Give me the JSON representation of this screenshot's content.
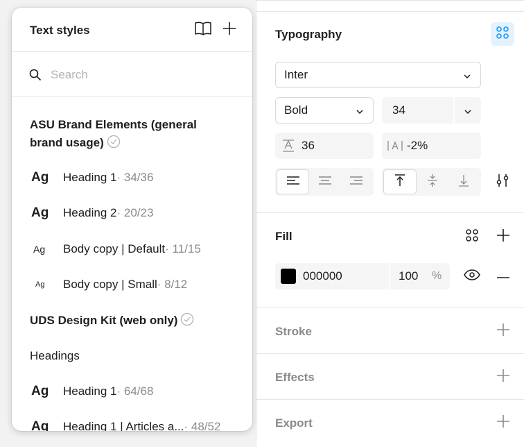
{
  "popover": {
    "title": "Text styles",
    "search_placeholder": "Search",
    "groups": [
      {
        "title": "ASU Brand Elements (general brand usage)",
        "styles": [
          {
            "ag": "Ag",
            "name": "Heading 1",
            "size": " · 34/36"
          },
          {
            "ag": "Ag",
            "name": "Heading 2",
            "size": " · 20/23"
          },
          {
            "ag": "Ag",
            "name": "Body copy | Default",
            "size": " · 11/15"
          },
          {
            "ag": "Ag",
            "name": "Body copy | Small",
            "size": " · 8/12"
          }
        ]
      },
      {
        "title": "UDS Design Kit (web only)",
        "subheading": "Headings",
        "styles": [
          {
            "ag": "Ag",
            "name": "Heading 1",
            "size": " · 64/68"
          },
          {
            "ag": "Ag",
            "name": "Heading 1 | Articles a...",
            "size": " · 48/52"
          }
        ]
      }
    ]
  },
  "typography": {
    "title": "Typography",
    "font_family": "Inter",
    "font_weight": "Bold",
    "font_size": "34",
    "line_height": "36",
    "letter_spacing": "-2%"
  },
  "fill": {
    "title": "Fill",
    "hex": "000000",
    "opacity": "100",
    "opacity_unit": "%",
    "swatch_color": "#000000"
  },
  "stroke": {
    "title": "Stroke"
  },
  "effects": {
    "title": "Effects"
  },
  "export": {
    "title": "Export"
  },
  "colors": {
    "accent": "#0d99ff",
    "accent_bg": "#e5f2fe"
  }
}
